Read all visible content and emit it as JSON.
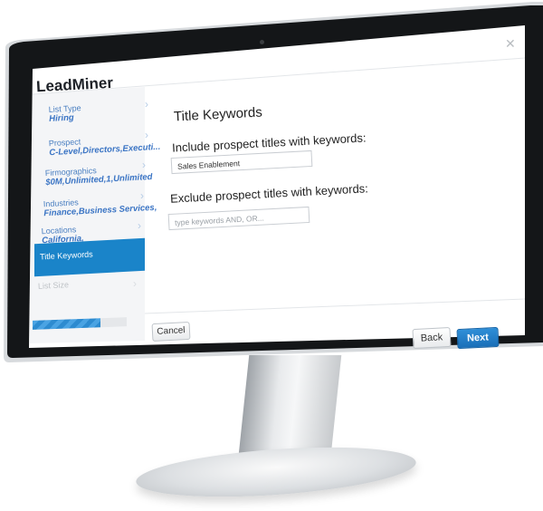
{
  "app": {
    "brand": "LeadMiner"
  },
  "sidebar": {
    "items": [
      {
        "label": "List Type",
        "value": "Hiring"
      },
      {
        "label": "Prospect",
        "value": "C-Level,Directors,Executi..."
      },
      {
        "label": "Firmographics",
        "value": "$0M,Unlimited,1,Unlimited"
      },
      {
        "label": "Industries",
        "value": "Finance,Business Services,"
      },
      {
        "label": "Locations",
        "value": "California,"
      }
    ],
    "active_item": "Title Keywords",
    "disabled_item": "List Size",
    "progress_fraction": 0.72
  },
  "main": {
    "title": "Title Keywords",
    "include_label": "Include prospect titles with keywords:",
    "include_value": "Sales Enablement",
    "exclude_label": "Exclude prospect titles with keywords:",
    "exclude_placeholder": "type keywords AND, OR..."
  },
  "buttons": {
    "cancel": "Cancel",
    "back": "Back",
    "next": "Next"
  },
  "colors": {
    "accent": "#1a84c9",
    "link": "#3a74c4",
    "bezel": "#15181b"
  }
}
